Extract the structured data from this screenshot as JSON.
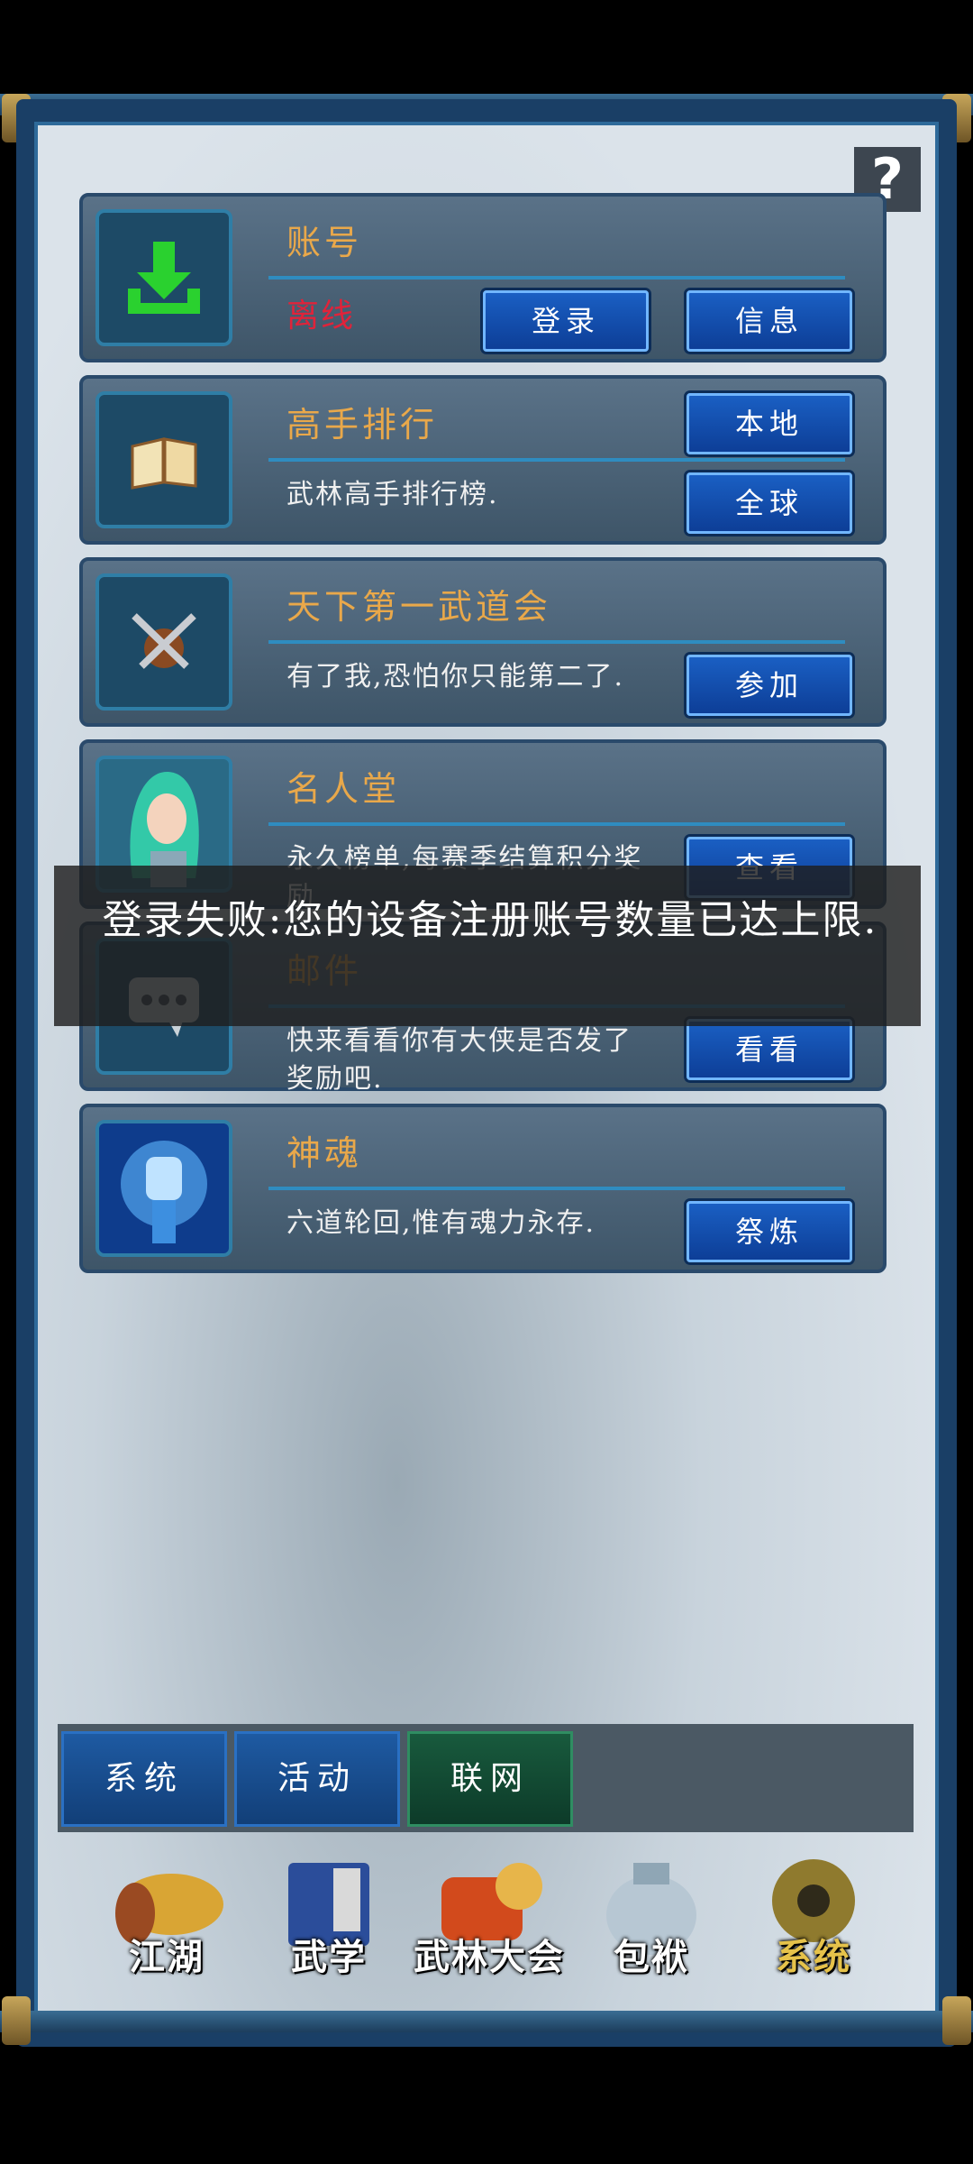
{
  "rows": [
    {
      "title": "账号",
      "status": "离线",
      "buttons": [
        "登录",
        "信息"
      ]
    },
    {
      "title": "高手排行",
      "desc": "武林高手排行榜.",
      "buttons": [
        "本地",
        "全球"
      ]
    },
    {
      "title": "天下第一武道会",
      "desc": "有了我,恐怕你只能第二了.",
      "buttons": [
        "参加"
      ]
    },
    {
      "title": "名人堂",
      "desc": "永久榜单,每赛季结算积分奖励",
      "buttons": [
        "查看"
      ]
    },
    {
      "title": "邮件",
      "desc": "快来看看你有大侠是否发了奖励吧.",
      "buttons": [
        "看看"
      ]
    },
    {
      "title": "神魂",
      "desc": "六道轮回,惟有魂力永存.",
      "buttons": [
        "祭炼"
      ]
    }
  ],
  "toast": "登录失败:您的设备注册账号数量已达上限.",
  "tabs": [
    "系统",
    "活动",
    "联网"
  ],
  "nav": [
    "江湖",
    "武学",
    "武林大会",
    "包袱",
    "系统"
  ],
  "help": "?",
  "colors": {
    "title": "#e9a84a",
    "offline": "#e0233a",
    "button": "#1a5fc3"
  }
}
